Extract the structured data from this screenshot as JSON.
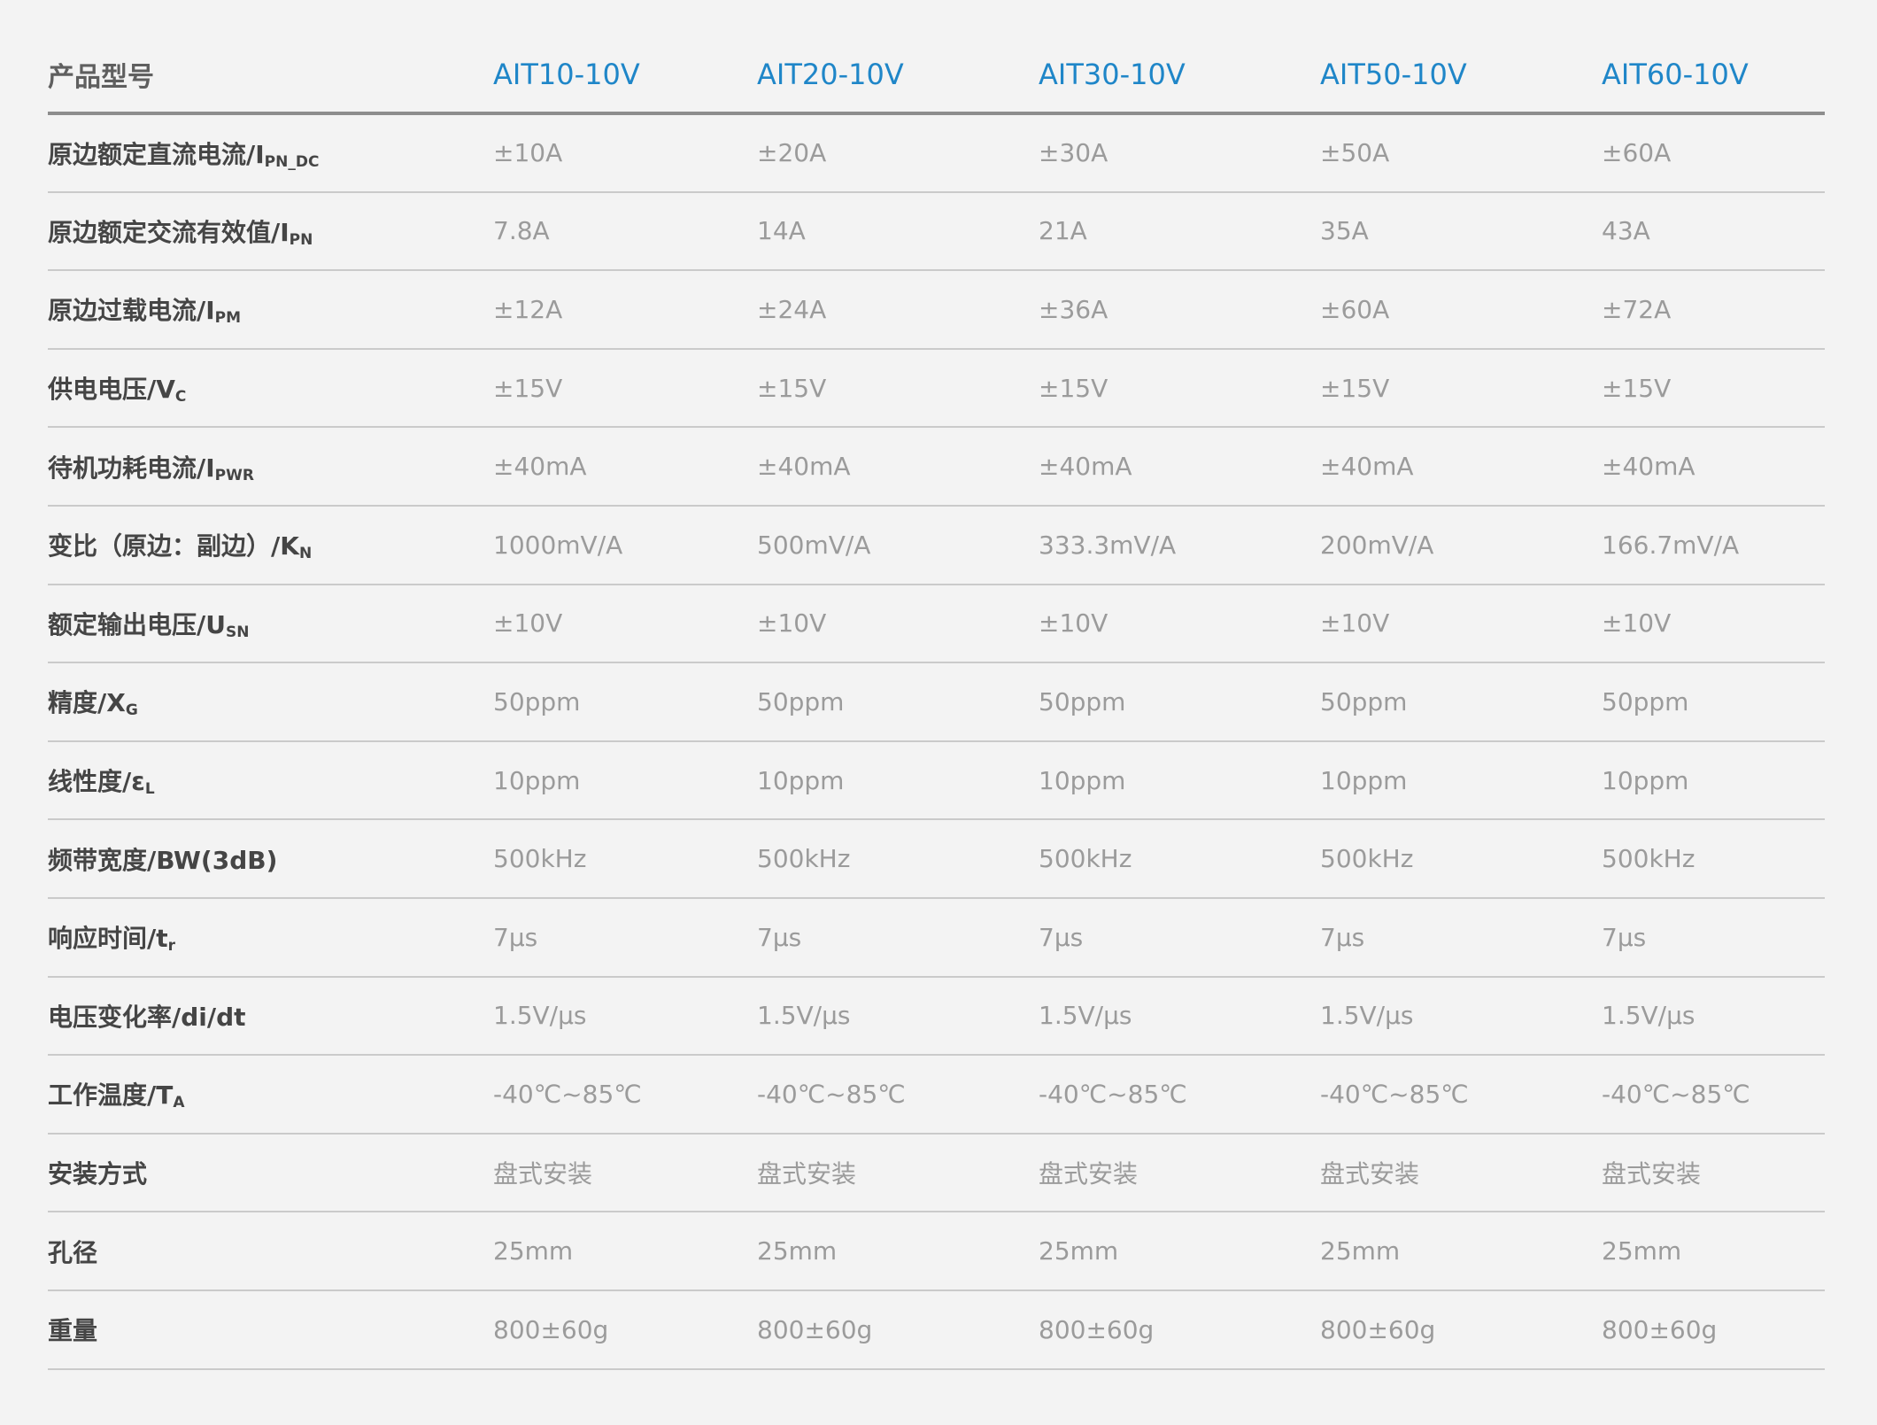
{
  "header": {
    "label": "产品型号",
    "models": [
      "AIT10-10V",
      "AIT20-10V",
      "AIT30-10V",
      "AIT50-10V",
      "AIT60-10V"
    ]
  },
  "rows": [
    {
      "label": "原边额定直流电流/I",
      "sub": "PN_DC",
      "values": [
        "±10A",
        "±20A",
        "±30A",
        "±50A",
        "±60A"
      ]
    },
    {
      "label": "原边额定交流有效值/I",
      "sub": "PN",
      "values": [
        "7.8A",
        "14A",
        "21A",
        "35A",
        "43A"
      ]
    },
    {
      "label": "原边过载电流/I",
      "sub": "PM",
      "values": [
        "±12A",
        "±24A",
        "±36A",
        "±60A",
        "±72A"
      ]
    },
    {
      "label": "供电电压/V",
      "sub": "C",
      "values": [
        "±15V",
        "±15V",
        "±15V",
        "±15V",
        "±15V"
      ]
    },
    {
      "label": "待机功耗电流/I",
      "sub": "PWR",
      "values": [
        "±40mA",
        "±40mA",
        "±40mA",
        "±40mA",
        "±40mA"
      ]
    },
    {
      "label": "变比（原边：副边）/K",
      "sub": "N",
      "values": [
        "1000mV/A",
        "500mV/A",
        "333.3mV/A",
        "200mV/A",
        "166.7mV/A"
      ]
    },
    {
      "label": "额定输出电压/U",
      "sub": "SN",
      "values": [
        "±10V",
        "±10V",
        "±10V",
        "±10V",
        "±10V"
      ]
    },
    {
      "label": "精度/X",
      "sub": "G",
      "values": [
        "50ppm",
        "50ppm",
        "50ppm",
        "50ppm",
        "50ppm"
      ]
    },
    {
      "label": "线性度/ε",
      "sub": "L",
      "values": [
        "10ppm",
        "10ppm",
        "10ppm",
        "10ppm",
        "10ppm"
      ]
    },
    {
      "label": "频带宽度/BW(3dB)",
      "sub": "",
      "values": [
        "500kHz",
        "500kHz",
        "500kHz",
        "500kHz",
        "500kHz"
      ]
    },
    {
      "label": "响应时间/t",
      "sub": "r",
      "values": [
        "7μs",
        "7μs",
        "7μs",
        "7μs",
        "7μs"
      ]
    },
    {
      "label": "电压变化率/di/dt",
      "sub": "",
      "values": [
        "1.5V/μs",
        "1.5V/μs",
        "1.5V/μs",
        "1.5V/μs",
        "1.5V/μs"
      ]
    },
    {
      "label": "工作温度/T",
      "sub": "A",
      "values": [
        " -40℃~85℃",
        " -40℃~85℃",
        " -40℃~85℃",
        " -40℃~85℃",
        " -40℃~85℃"
      ]
    },
    {
      "label": "安装方式",
      "sub": "",
      "values": [
        "盘式安装",
        "盘式安装",
        "盘式安装",
        "盘式安装",
        "盘式安装"
      ]
    },
    {
      "label": "孔径",
      "sub": "",
      "values": [
        "25mm",
        "25mm",
        "25mm",
        "25mm",
        "25mm"
      ]
    },
    {
      "label": "重量",
      "sub": "",
      "values": [
        "800±60g",
        "800±60g",
        "800±60g",
        "800±60g",
        "800±60g"
      ]
    }
  ]
}
